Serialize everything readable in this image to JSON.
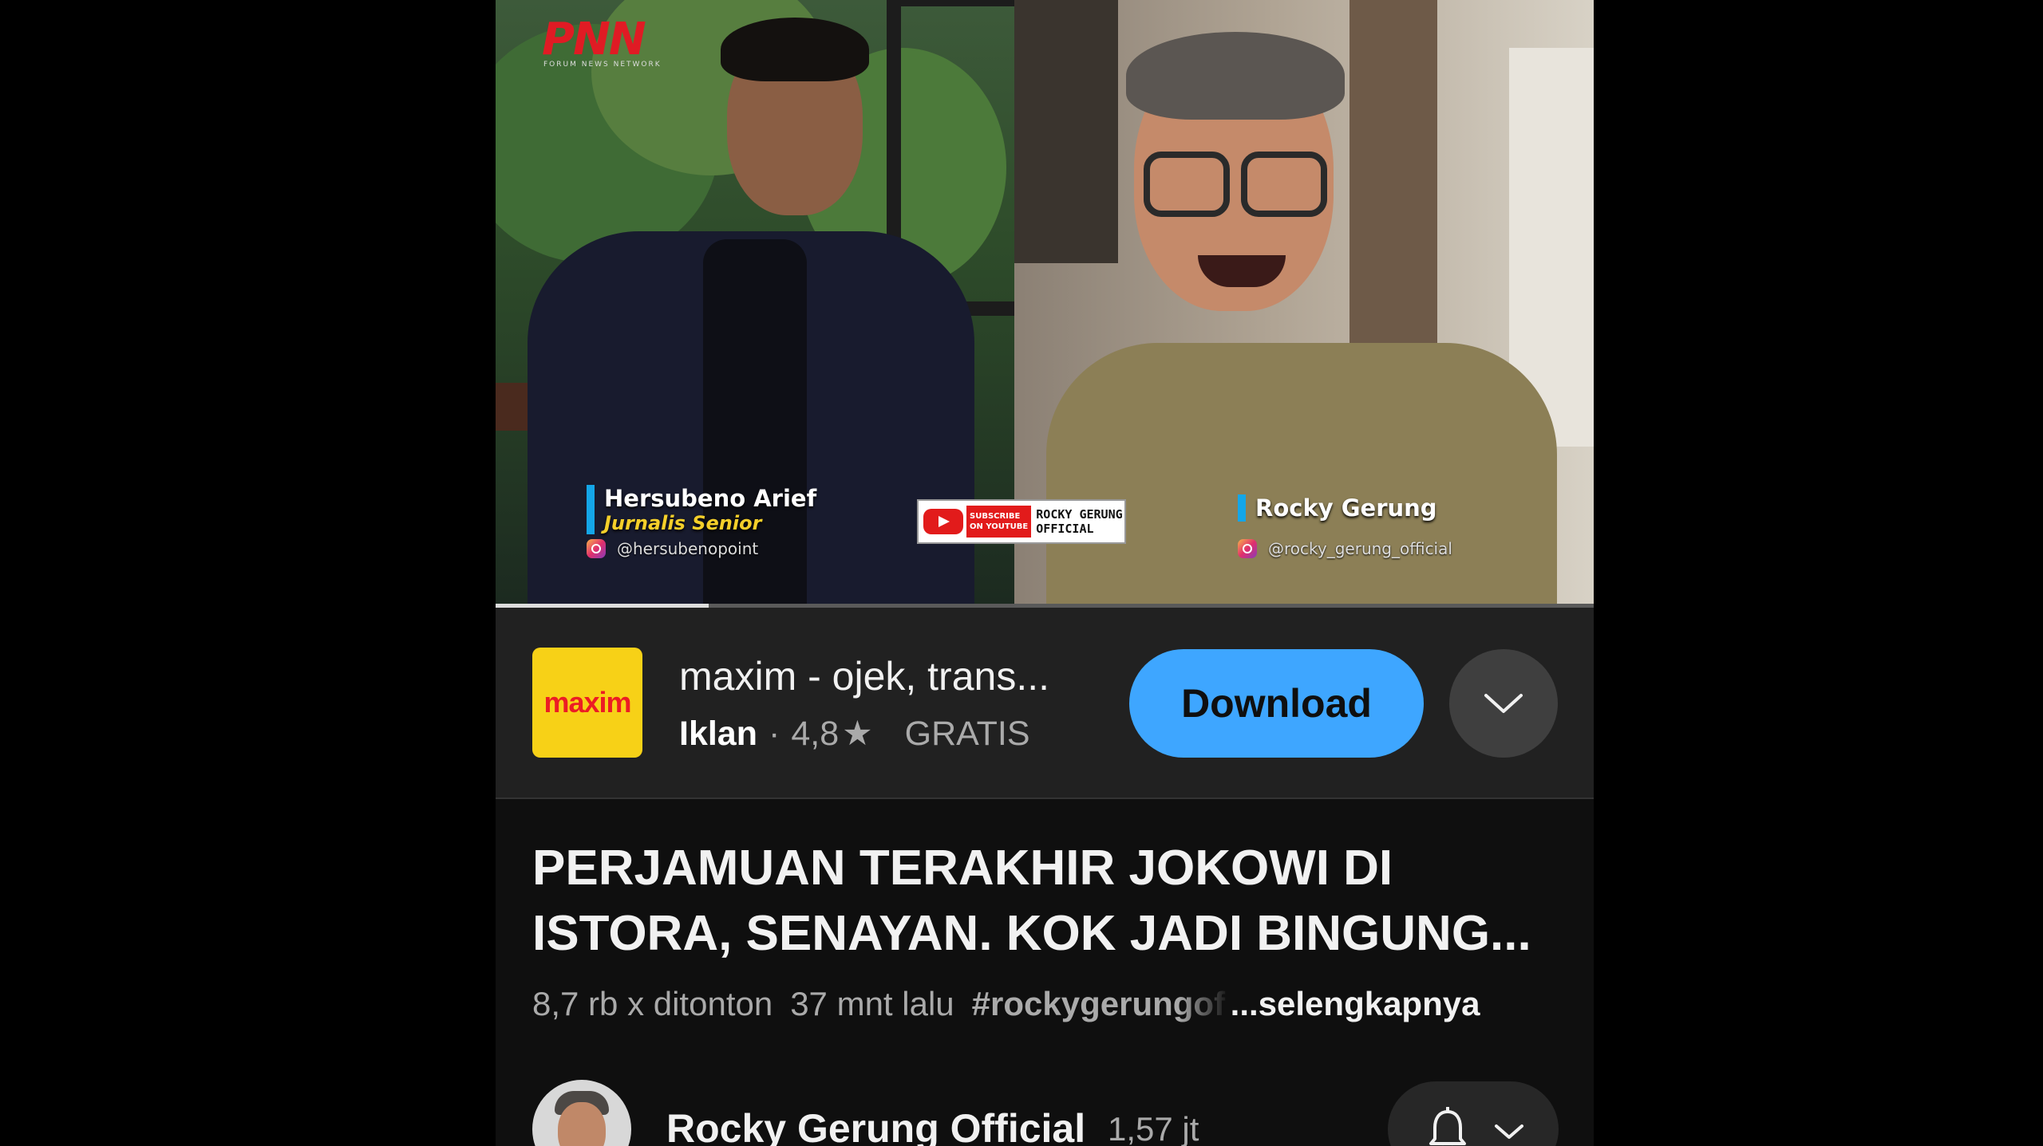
{
  "video": {
    "channel_logo_text": "PNN",
    "channel_logo_sub": "FORUM NEWS NETWORK",
    "left_speaker": {
      "name": "Hersubeno Arief",
      "role": "Jurnalis Senior",
      "instagram": "@hersubenopoint"
    },
    "right_speaker": {
      "name": "Rocky Gerung",
      "instagram": "@rocky_gerung_official"
    },
    "subscribe_badge": {
      "line1": "SUBSCRIBE",
      "line2": "ON YOUTUBE",
      "channel_line1": "ROCKY GERUNG",
      "channel_line2": "OFFICIAL"
    },
    "progress_fraction": 0.194
  },
  "ad": {
    "logo_text": "maxim",
    "title": "maxim - ojek, trans...",
    "label": "Iklan",
    "separator": "·",
    "rating": "4,8",
    "star_icon": "★",
    "price": "GRATIS",
    "download_label": "Download",
    "expand_icon": "chevron-down-icon",
    "colors": {
      "logo_bg": "#f7d117",
      "logo_text": "#ec1c24",
      "button": "#3ea6ff"
    }
  },
  "details": {
    "title": "PERJAMUAN TERAKHIR JOKOWI DI ISTORA, SENAYAN. KOK JADI BINGUNG...",
    "views": "8,7 rb x ditonton",
    "time": "37 mnt lalu",
    "hashtag": "#rockygerungof",
    "more": "...selengkapnya"
  },
  "channel": {
    "name": "Rocky Gerung Official",
    "subscribers": "1,57 jt",
    "bell_icon": "bell-icon",
    "chevron_icon": "chevron-down-icon"
  }
}
